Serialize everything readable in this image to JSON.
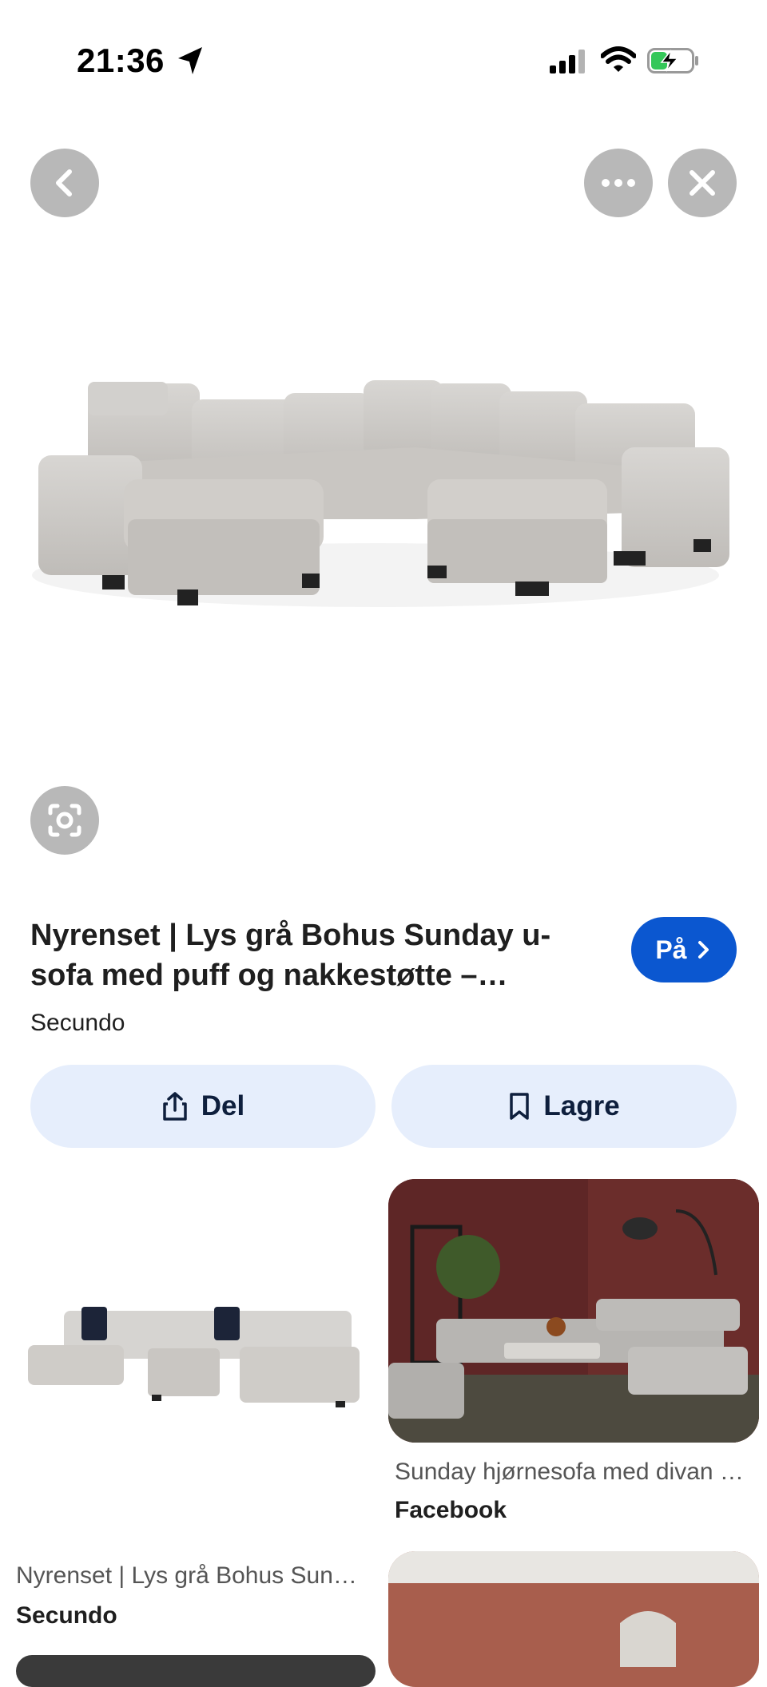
{
  "status_bar": {
    "time": "21:36"
  },
  "top_bar": {
    "back_icon": "chevron-left-icon",
    "more_icon": "more-horizontal-icon",
    "close_icon": "close-icon"
  },
  "hero": {
    "alt": "light grey u-sofa with ottoman",
    "lens_icon": "lens-search-icon"
  },
  "result": {
    "title": "Nyrenset | Lys grå Bohus Sunday u-sofa med puff og nakkestøtte – Secundo",
    "source": "Secundo",
    "visit_label": "På"
  },
  "actions": {
    "share_label": "Del",
    "save_label": "Lagre"
  },
  "related": [
    {
      "title": "Nyrenset | Lys grå Bohus Sunday u-sofa med puff og nakkestøtte",
      "source": "Secundo"
    },
    {
      "title": "Sunday hjørnesofa med divan og puff",
      "source": "Facebook"
    }
  ],
  "colors": {
    "accent": "#0b57d0",
    "pill_bg": "#e6eefc",
    "overlay_btn": "#b8b8b8"
  }
}
